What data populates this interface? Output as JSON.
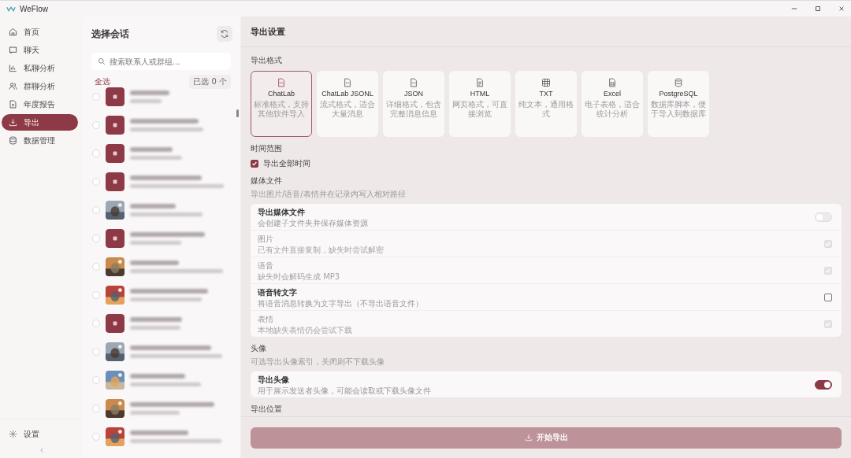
{
  "window": {
    "title": "WeFlow"
  },
  "sidebar": {
    "items": [
      {
        "label": "首页",
        "selected": false
      },
      {
        "label": "聊天",
        "selected": false
      },
      {
        "label": "私聊分析",
        "selected": false
      },
      {
        "label": "群聊分析",
        "selected": false
      },
      {
        "label": "年度报告",
        "selected": false
      },
      {
        "label": "导出",
        "selected": true
      },
      {
        "label": "数据管理",
        "selected": false
      }
    ],
    "settings": "设置"
  },
  "sessions": {
    "title": "选择会话",
    "search": {
      "placeholder": "搜索联系人或群组..."
    },
    "select_all": "全选",
    "selected_count": "已选 0 个",
    "rows": [
      {
        "kind": "group",
        "selected": false
      },
      {
        "kind": "group",
        "selected": false
      },
      {
        "kind": "group",
        "selected": false
      },
      {
        "kind": "group",
        "selected": false
      },
      {
        "kind": "picture",
        "selected": false
      },
      {
        "kind": "group",
        "selected": false
      },
      {
        "kind": "picture",
        "selected": false
      },
      {
        "kind": "picture",
        "selected": false
      },
      {
        "kind": "group",
        "selected": false
      },
      {
        "kind": "picture",
        "selected": false
      },
      {
        "kind": "picture",
        "selected": false
      },
      {
        "kind": "picture",
        "selected": false
      },
      {
        "kind": "picture",
        "selected": false
      }
    ]
  },
  "settings": {
    "title": "导出设置",
    "format": {
      "label": "导出格式",
      "options": [
        {
          "name": "ChatLab",
          "description": "标准格式，支持其他软件导入",
          "selected": true
        },
        {
          "name": "ChatLab JSONL",
          "description": "流式格式，适合大量消息",
          "selected": false
        },
        {
          "name": "JSON",
          "description": "详细格式，包含完整消息信息",
          "selected": false
        },
        {
          "name": "HTML",
          "description": "网页格式，可直接浏览",
          "selected": false
        },
        {
          "name": "TXT",
          "description": "纯文本，通用格式",
          "selected": false
        },
        {
          "name": "Excel",
          "description": "电子表格，适合统计分析",
          "selected": false
        },
        {
          "name": "PostgreSQL",
          "description": "数据库脚本，便于导入到数据库",
          "selected": false
        }
      ]
    },
    "time_range": {
      "label": "时间范围",
      "option": {
        "label": "导出全部时间",
        "checked": true
      }
    },
    "media": {
      "label": "媒体文件",
      "hint": "导出图片/语音/表情并在记录内写入相对路径",
      "options": [
        {
          "kind": "toggle",
          "label": "导出媒体文件",
          "description": "会创建子文件夹并保存媒体资源",
          "checked": false
        },
        {
          "kind": "checkbox",
          "label": "图片",
          "description": "已有文件直接复制，缺失时尝试解密",
          "checked": true,
          "disabled": true
        },
        {
          "kind": "checkbox",
          "label": "语音",
          "description": "缺失时会解码生成 MP3",
          "checked": true,
          "disabled": true
        },
        {
          "kind": "checkbox",
          "label": "语音转文字",
          "description": "将语音消息转换为文字导出（不导出语音文件）",
          "checked": false,
          "disabled": false
        },
        {
          "kind": "checkbox",
          "label": "表情",
          "description": "本地缺失表情仍会尝试下载",
          "checked": true,
          "disabled": true
        }
      ]
    },
    "avatar": {
      "label": "头像",
      "hint": "可选导出头像索引，关闭则不下载头像",
      "options": [
        {
          "kind": "toggle",
          "label": "导出头像",
          "description": "用于展示发送者头像，可能会读取或下载头像文件",
          "checked": true
        }
      ]
    },
    "location": {
      "label": "导出位置"
    },
    "start_button": {
      "label": "开始导出",
      "disabled": true
    }
  }
}
